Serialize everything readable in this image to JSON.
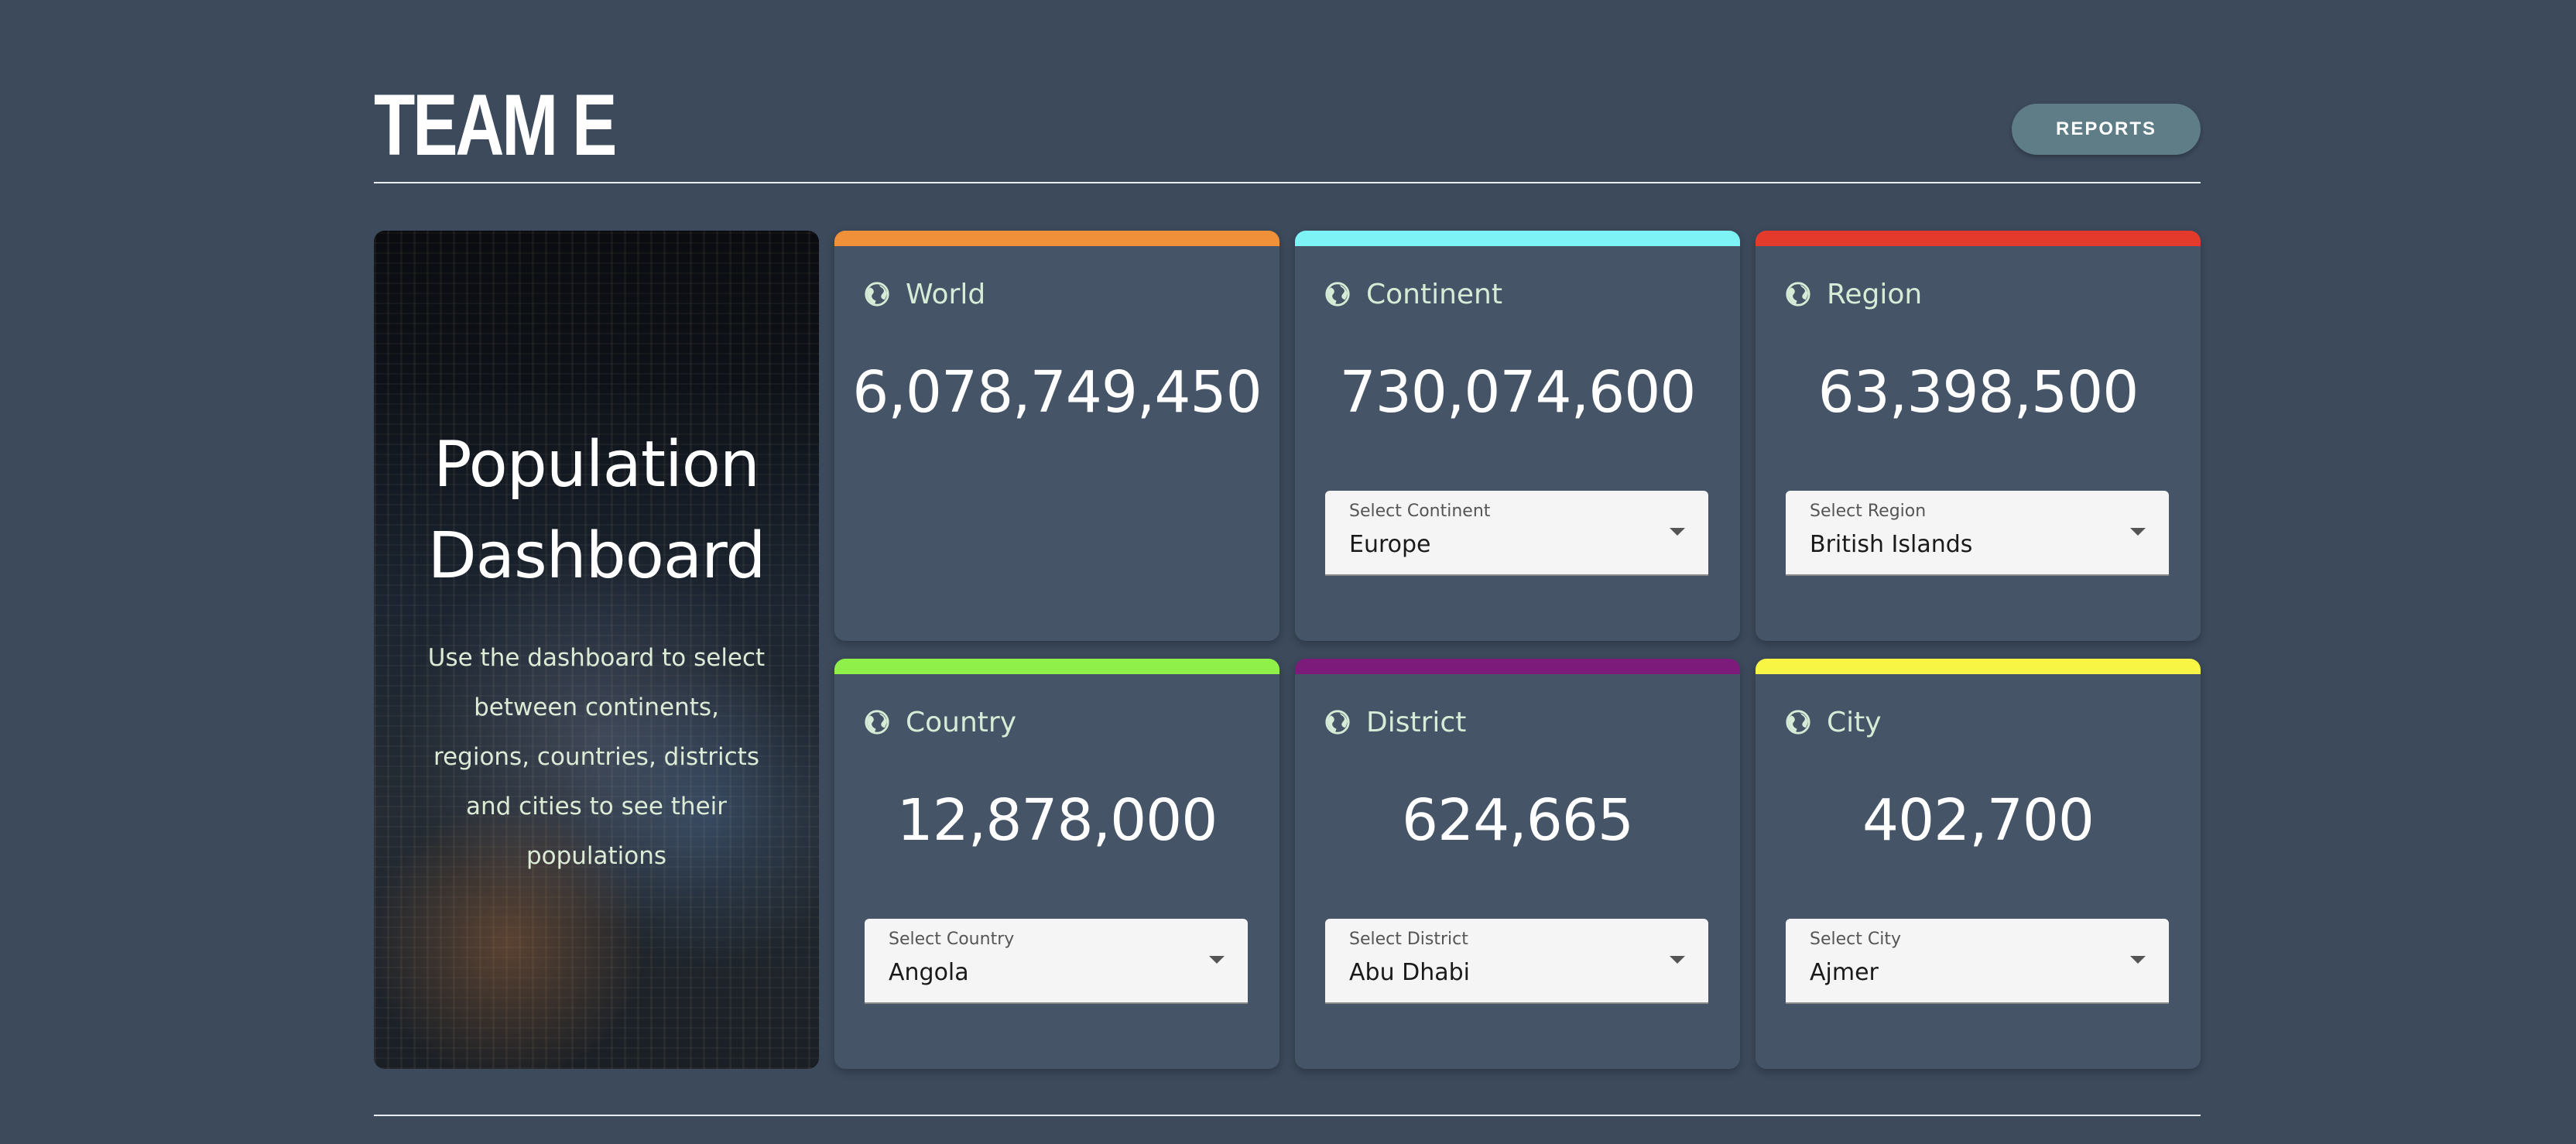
{
  "header": {
    "title": "TEAM E",
    "reports_label": "REPORTS"
  },
  "hero": {
    "title_line1": "Population",
    "title_line2": "Dashboard",
    "description_lines": [
      "Use the dashboard to select",
      "between continents,",
      "regions, countries, districts",
      "and cities to see their",
      "populations"
    ]
  },
  "cards": {
    "world": {
      "label": "World",
      "value": "6,078,749,450",
      "accent": "#f0913a",
      "icon": "globe-icon"
    },
    "continent": {
      "label": "Continent",
      "value": "730,074,600",
      "accent": "#7df3f5",
      "icon": "globe-icon",
      "select_label": "Select Continent",
      "select_value": "Europe"
    },
    "region": {
      "label": "Region",
      "value": "63,398,500",
      "accent": "#e33a2b",
      "icon": "globe-icon",
      "select_label": "Select Region",
      "select_value": "British Islands"
    },
    "country": {
      "label": "Country",
      "value": "12,878,000",
      "accent": "#8ff04a",
      "icon": "globe-icon",
      "select_label": "Select Country",
      "select_value": "Angola"
    },
    "district": {
      "label": "District",
      "value": "624,665",
      "accent": "#7d1b7a",
      "icon": "globe-icon",
      "select_label": "Select District",
      "select_value": "Abu Dhabi"
    },
    "city": {
      "label": "City",
      "value": "402,700",
      "accent": "#f9f545",
      "icon": "globe-icon",
      "select_label": "Select City",
      "select_value": "Ajmer"
    }
  },
  "colors": {
    "background": "#3c4a5c",
    "card": "#455466",
    "button": "#5e7d86",
    "label_text": "#d7ecd6"
  }
}
